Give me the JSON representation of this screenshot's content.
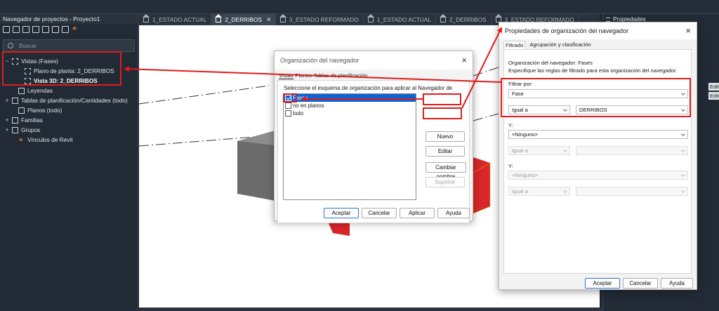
{
  "browser": {
    "title": "Navegador de proyectos - Proyecto1",
    "search_placeholder": "Buscar",
    "tree": [
      {
        "label": "Vistas (Fases)",
        "exp": "−",
        "indent": 0,
        "icon": "views-icon"
      },
      {
        "label": "Plano de planta: 2_DERRIBOS",
        "exp": "",
        "indent": 2,
        "icon": "floor-plan-icon"
      },
      {
        "label": "Vista 3D: 2_DERRIBOS",
        "exp": "",
        "indent": 2,
        "icon": "3d-view-icon",
        "bold": true
      },
      {
        "label": "Leyendas",
        "exp": "",
        "indent": 1,
        "icon": "legend-icon"
      },
      {
        "label": "Tablas de planificación/Cantidades (todo)",
        "exp": "+",
        "indent": 0,
        "icon": "schedule-icon"
      },
      {
        "label": "Planos (todo)",
        "exp": "",
        "indent": 1,
        "icon": "sheet-icon"
      },
      {
        "label": "Familias",
        "exp": "+",
        "indent": 0,
        "icon": "families-icon"
      },
      {
        "label": "Grupos",
        "exp": "+",
        "indent": 0,
        "icon": "groups-icon"
      },
      {
        "label": "Vínculos de Revit",
        "exp": "",
        "indent": 1,
        "icon": "link-icon"
      }
    ]
  },
  "tabs": [
    {
      "label": "1_ESTADO ACTUAL",
      "active": false,
      "closable": false
    },
    {
      "label": "2_DERRIBOS",
      "active": true,
      "closable": true
    },
    {
      "label": "3_ESTADO REFORMADO",
      "active": false,
      "closable": false
    },
    {
      "label": "1_ESTADO ACTUAL",
      "active": false,
      "closable": false
    },
    {
      "label": "2_DERRIBOS",
      "active": false,
      "closable": false
    },
    {
      "label": "3_ESTADO REFORMADO",
      "active": false,
      "closable": false
    }
  ],
  "properties": {
    "title": "Propiedades",
    "edit_label_1": "Editar",
    "edit_label_2": "Editar"
  },
  "org_dialog": {
    "title": "Organización del navegador",
    "tabs": [
      "Vistas",
      "Planos",
      "Tablas de planificación"
    ],
    "instruction": "Seleccione el esquema de organización para aplicar al Navegador de",
    "items": [
      {
        "label": "Fases",
        "checked": true,
        "selected": true
      },
      {
        "label": "no en planos",
        "checked": false,
        "selected": false
      },
      {
        "label": "todo",
        "checked": false,
        "selected": false
      }
    ],
    "btn_new": "Nuevo",
    "btn_edit": "Editar",
    "btn_rename": "Cambiar nombre",
    "btn_delete": "Suprimir",
    "btn_accept": "Aceptar",
    "btn_cancel": "Cancelar",
    "btn_apply": "Aplicar",
    "btn_help": "Ayuda"
  },
  "filter_dialog": {
    "title": "Propiedades de organización del navegador",
    "tab_filter": "Filtrado",
    "tab_group": "Agrupación y clasificación",
    "org_name": "Organización del navegador: Fases",
    "instruction": "Especifique las reglas de filtrado para esta organización del navegador.",
    "filter_by_label": "Filtrar por:",
    "filter_field": "Fase",
    "operator": "Igual a",
    "value": "DERRIBOS",
    "and_label_1": "Y:",
    "field_2": "<Ninguno>",
    "operator_2": "Igual a",
    "and_label_2": "Y:",
    "field_3": "<Ninguno>",
    "operator_3": "Igual a",
    "btn_accept": "Aceptar",
    "btn_cancel": "Cancelar",
    "btn_help": "Ayuda"
  },
  "colors": {
    "annotation_red": "#e01b1b",
    "selection_blue": "#0a64d6",
    "phase_red": "#d8262a",
    "link_orange": "#e98b3a"
  }
}
